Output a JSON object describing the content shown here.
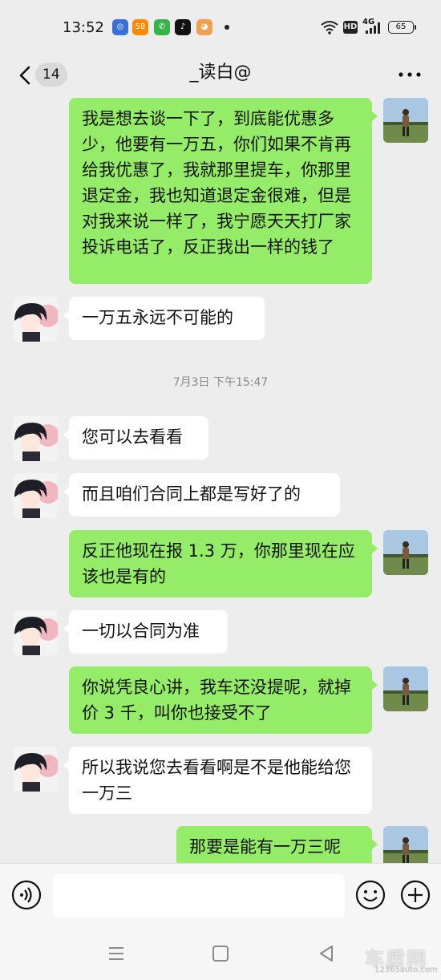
{
  "status_bar": {
    "time": "13:52",
    "app_icons": [
      {
        "name": "app-icon-1",
        "glyph": "◎",
        "color": "#3a6fd8"
      },
      {
        "name": "app-icon-58",
        "glyph": "58",
        "color": "#ff8a00"
      },
      {
        "name": "app-icon-phone",
        "glyph": "✆",
        "color": "#38b24a"
      },
      {
        "name": "app-icon-tiktok",
        "glyph": "♪",
        "color": "#111111"
      },
      {
        "name": "app-icon-cat",
        "glyph": "◕",
        "color": "#f0a050"
      }
    ],
    "hd_label": "HD",
    "network_label": "4G",
    "battery": "65"
  },
  "header": {
    "unread_count": "14",
    "title": "_读白@"
  },
  "messages": [
    {
      "side": "out",
      "text": "我是想去谈一下了，到底能优惠多少，他要有一万五，你们如果不肯再给我优惠了，我就那里提车，你那里退定金，我也知道退定金很难，但是对我来说一样了，我宁愿天天打厂家投诉电话了，反正我出一样的钱了"
    },
    {
      "side": "in",
      "text": "一万五永远不可能的"
    },
    {
      "type": "time",
      "text": "7月3日 下午15:47"
    },
    {
      "side": "in",
      "text": "您可以去看看"
    },
    {
      "side": "in",
      "text": "而且咱们合同上都是写好了的"
    },
    {
      "side": "out",
      "text": "反正他现在报 1.3 万，你那里现在应该也是有的"
    },
    {
      "side": "in",
      "text": "一切以合同为准"
    },
    {
      "side": "out",
      "text": "你说凭良心讲，我车还没提呢，就掉价 3 千，叫你也接受不了"
    },
    {
      "side": "in",
      "text": "所以我说您去看看啊是不是他能给您一万三"
    },
    {
      "side": "out",
      "text": "那要是能有一万三呢"
    }
  ],
  "input": {
    "value": "",
    "placeholder": ""
  },
  "colors": {
    "sent_bubble": "#95ec69",
    "received_bubble": "#ffffff",
    "background": "#ededed"
  },
  "icons": {
    "back": "chevron-left-icon",
    "more": "more-icon",
    "voice": "voice-icon",
    "emoji": "emoji-icon",
    "plus": "plus-icon",
    "nav_menu": "menu-icon",
    "nav_home": "home-icon",
    "nav_back": "back-triangle-icon"
  },
  "watermark": {
    "main": "车质网",
    "sub": "12365auto.com"
  }
}
